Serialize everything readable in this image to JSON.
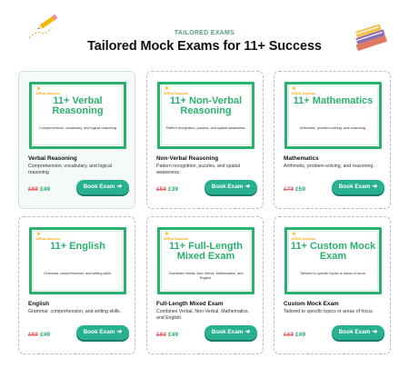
{
  "header": {
    "eyebrow": "TAILORED EXAMS",
    "title": "Tailored Mock Exams for 11+ Success"
  },
  "logo_text": "11Plus Success",
  "colors": {
    "accent_green": "#2ab26d",
    "button": "#27b191",
    "old_price": "#e26b6b",
    "new_price": "#2aa673"
  },
  "cards": [
    {
      "thumb_title": "11+ Verbal Reasoning",
      "thumb_desc": "Comprehension, vocabulary, and logical reasoning",
      "name": "Verbal Reasoning",
      "desc": "Comprehension, vocabulary, and logical reasoning",
      "old_price": "£69",
      "new_price": "£49",
      "button": "Book Exam"
    },
    {
      "thumb_title": "11+ Non-Verbal Reasoning",
      "thumb_desc": "Pattern recognition, puzzles, and spatial awareness.",
      "name": "Non-Verbal Reasoning",
      "desc": "Pattern recognition, puzzles, and spatial awareness.",
      "old_price": "£59",
      "new_price": "£39",
      "button": "Book Exam"
    },
    {
      "thumb_title": "11+ Mathematics",
      "thumb_desc": "Arithmetic, problem-solving, and reasoning.",
      "name": "Mathematics",
      "desc": "Arithmetic, problem-solving, and reasoning.",
      "old_price": "£79",
      "new_price": "£59",
      "button": "Book Exam"
    },
    {
      "thumb_title": "11+ English",
      "thumb_desc": "Grammar, comprehension, and writing skills.",
      "name": "English",
      "desc": "Grammar, comprehension, and writing skills.",
      "old_price": "£69",
      "new_price": "£49",
      "button": "Book Exam"
    },
    {
      "thumb_title": "11+ Full-Length Mixed Exam",
      "thumb_desc": "Combines Verbal, Non-Verbal, Mathematics, and English.",
      "name": "Full-Length Mixed Exam",
      "desc": "Combines Verbal, Non-Verbal, Mathematics, and English.",
      "old_price": "£69",
      "new_price": "£49",
      "button": "Book Exam"
    },
    {
      "thumb_title": "11+ Custom Mock Exam",
      "thumb_desc": "Tailored to specific topics or areas of focus.",
      "name": "Custom Mock Exam",
      "desc": "Tailored to specific topics or areas of focus.",
      "old_price": "£69",
      "new_price": "£49",
      "button": "Book Exam"
    }
  ]
}
